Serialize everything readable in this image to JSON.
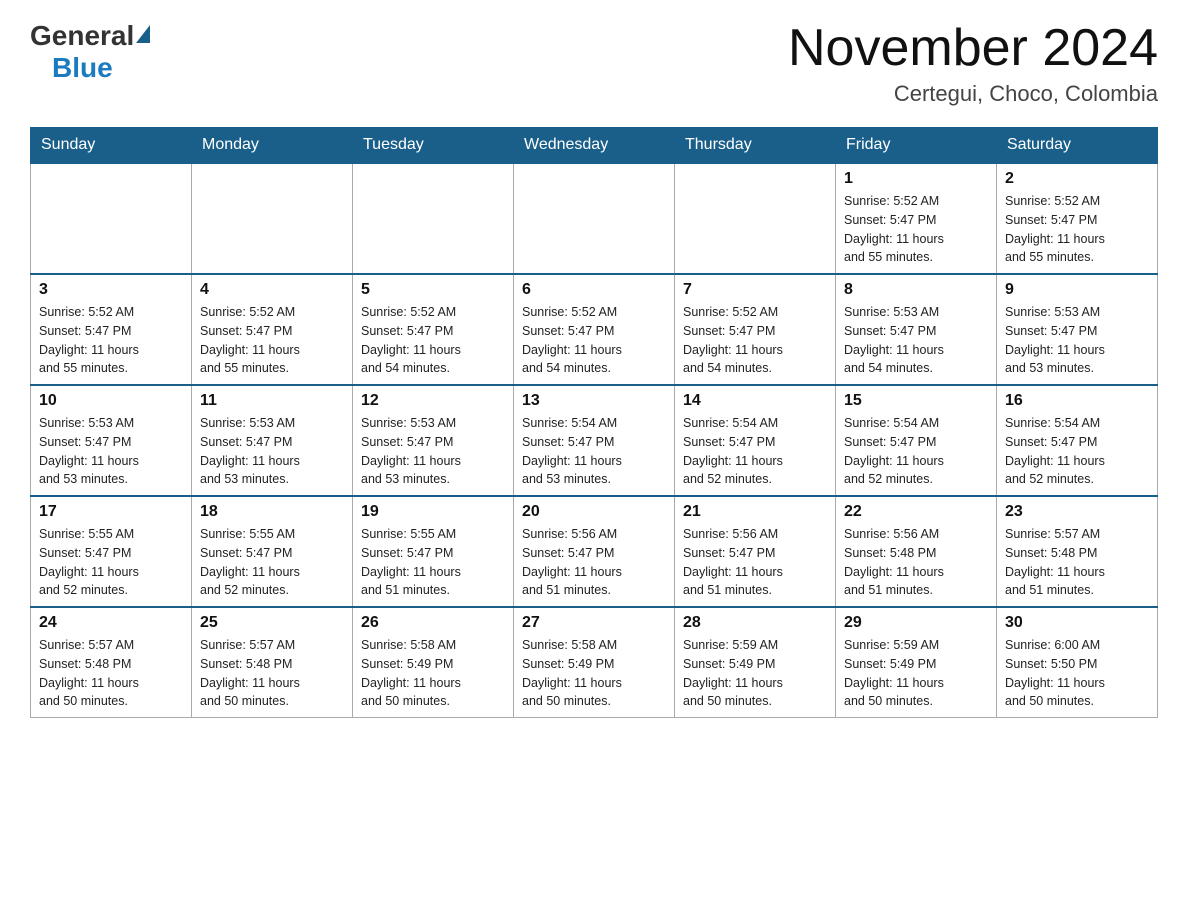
{
  "header": {
    "logo_general": "General",
    "logo_blue": "Blue",
    "month_title": "November 2024",
    "subtitle": "Certegui, Choco, Colombia"
  },
  "days_of_week": [
    "Sunday",
    "Monday",
    "Tuesday",
    "Wednesday",
    "Thursday",
    "Friday",
    "Saturday"
  ],
  "weeks": [
    {
      "days": [
        {
          "num": "",
          "info": ""
        },
        {
          "num": "",
          "info": ""
        },
        {
          "num": "",
          "info": ""
        },
        {
          "num": "",
          "info": ""
        },
        {
          "num": "",
          "info": ""
        },
        {
          "num": "1",
          "info": "Sunrise: 5:52 AM\nSunset: 5:47 PM\nDaylight: 11 hours\nand 55 minutes."
        },
        {
          "num": "2",
          "info": "Sunrise: 5:52 AM\nSunset: 5:47 PM\nDaylight: 11 hours\nand 55 minutes."
        }
      ]
    },
    {
      "days": [
        {
          "num": "3",
          "info": "Sunrise: 5:52 AM\nSunset: 5:47 PM\nDaylight: 11 hours\nand 55 minutes."
        },
        {
          "num": "4",
          "info": "Sunrise: 5:52 AM\nSunset: 5:47 PM\nDaylight: 11 hours\nand 55 minutes."
        },
        {
          "num": "5",
          "info": "Sunrise: 5:52 AM\nSunset: 5:47 PM\nDaylight: 11 hours\nand 54 minutes."
        },
        {
          "num": "6",
          "info": "Sunrise: 5:52 AM\nSunset: 5:47 PM\nDaylight: 11 hours\nand 54 minutes."
        },
        {
          "num": "7",
          "info": "Sunrise: 5:52 AM\nSunset: 5:47 PM\nDaylight: 11 hours\nand 54 minutes."
        },
        {
          "num": "8",
          "info": "Sunrise: 5:53 AM\nSunset: 5:47 PM\nDaylight: 11 hours\nand 54 minutes."
        },
        {
          "num": "9",
          "info": "Sunrise: 5:53 AM\nSunset: 5:47 PM\nDaylight: 11 hours\nand 53 minutes."
        }
      ]
    },
    {
      "days": [
        {
          "num": "10",
          "info": "Sunrise: 5:53 AM\nSunset: 5:47 PM\nDaylight: 11 hours\nand 53 minutes."
        },
        {
          "num": "11",
          "info": "Sunrise: 5:53 AM\nSunset: 5:47 PM\nDaylight: 11 hours\nand 53 minutes."
        },
        {
          "num": "12",
          "info": "Sunrise: 5:53 AM\nSunset: 5:47 PM\nDaylight: 11 hours\nand 53 minutes."
        },
        {
          "num": "13",
          "info": "Sunrise: 5:54 AM\nSunset: 5:47 PM\nDaylight: 11 hours\nand 53 minutes."
        },
        {
          "num": "14",
          "info": "Sunrise: 5:54 AM\nSunset: 5:47 PM\nDaylight: 11 hours\nand 52 minutes."
        },
        {
          "num": "15",
          "info": "Sunrise: 5:54 AM\nSunset: 5:47 PM\nDaylight: 11 hours\nand 52 minutes."
        },
        {
          "num": "16",
          "info": "Sunrise: 5:54 AM\nSunset: 5:47 PM\nDaylight: 11 hours\nand 52 minutes."
        }
      ]
    },
    {
      "days": [
        {
          "num": "17",
          "info": "Sunrise: 5:55 AM\nSunset: 5:47 PM\nDaylight: 11 hours\nand 52 minutes."
        },
        {
          "num": "18",
          "info": "Sunrise: 5:55 AM\nSunset: 5:47 PM\nDaylight: 11 hours\nand 52 minutes."
        },
        {
          "num": "19",
          "info": "Sunrise: 5:55 AM\nSunset: 5:47 PM\nDaylight: 11 hours\nand 51 minutes."
        },
        {
          "num": "20",
          "info": "Sunrise: 5:56 AM\nSunset: 5:47 PM\nDaylight: 11 hours\nand 51 minutes."
        },
        {
          "num": "21",
          "info": "Sunrise: 5:56 AM\nSunset: 5:47 PM\nDaylight: 11 hours\nand 51 minutes."
        },
        {
          "num": "22",
          "info": "Sunrise: 5:56 AM\nSunset: 5:48 PM\nDaylight: 11 hours\nand 51 minutes."
        },
        {
          "num": "23",
          "info": "Sunrise: 5:57 AM\nSunset: 5:48 PM\nDaylight: 11 hours\nand 51 minutes."
        }
      ]
    },
    {
      "days": [
        {
          "num": "24",
          "info": "Sunrise: 5:57 AM\nSunset: 5:48 PM\nDaylight: 11 hours\nand 50 minutes."
        },
        {
          "num": "25",
          "info": "Sunrise: 5:57 AM\nSunset: 5:48 PM\nDaylight: 11 hours\nand 50 minutes."
        },
        {
          "num": "26",
          "info": "Sunrise: 5:58 AM\nSunset: 5:49 PM\nDaylight: 11 hours\nand 50 minutes."
        },
        {
          "num": "27",
          "info": "Sunrise: 5:58 AM\nSunset: 5:49 PM\nDaylight: 11 hours\nand 50 minutes."
        },
        {
          "num": "28",
          "info": "Sunrise: 5:59 AM\nSunset: 5:49 PM\nDaylight: 11 hours\nand 50 minutes."
        },
        {
          "num": "29",
          "info": "Sunrise: 5:59 AM\nSunset: 5:49 PM\nDaylight: 11 hours\nand 50 minutes."
        },
        {
          "num": "30",
          "info": "Sunrise: 6:00 AM\nSunset: 5:50 PM\nDaylight: 11 hours\nand 50 minutes."
        }
      ]
    }
  ]
}
